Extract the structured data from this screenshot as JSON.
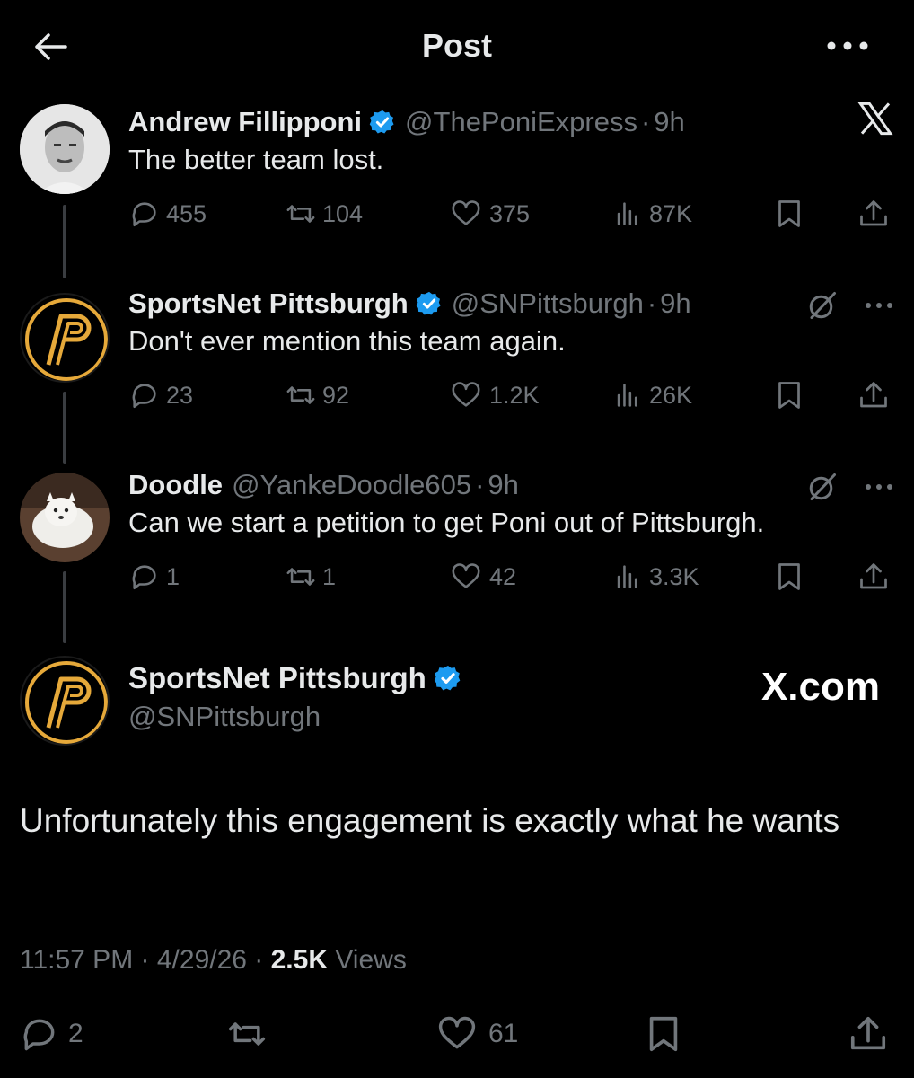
{
  "header": {
    "title": "Post"
  },
  "replies": [
    {
      "name": "Andrew Fillipponi",
      "handle": "@ThePoniExpress",
      "time": "9h",
      "text": "The better team lost.",
      "stats": {
        "replies": "455",
        "reposts": "104",
        "likes": "375",
        "views": "87K"
      }
    },
    {
      "name": "SportsNet Pittsburgh",
      "handle": "@SNPittsburgh",
      "time": "9h",
      "text": "Don't ever mention this team again.",
      "stats": {
        "replies": "23",
        "reposts": "92",
        "likes": "1.2K",
        "views": "26K"
      }
    },
    {
      "name": "Doodle",
      "handle": "@YankeDoodle605",
      "time": "9h",
      "text": "Can we start a petition to get Poni out of Pittsburgh.",
      "stats": {
        "replies": "1",
        "reposts": "1",
        "likes": "42",
        "views": "3.3K"
      }
    }
  ],
  "main": {
    "name": "SportsNet Pittsburgh",
    "handle": "@SNPittsburgh",
    "watermark": "X.com",
    "text": "Unfortunately this engagement is exactly what he wants",
    "time": "11:57 PM",
    "date": "4/29/26",
    "views_count": "2.5K",
    "views_label": "Views",
    "stats": {
      "replies": "2",
      "likes": "61"
    }
  },
  "colors": {
    "background": "#000000",
    "text": "#e7e9ea",
    "muted": "#71767b",
    "verified": "#1d9bf0",
    "snp_gold": "#e6a93a"
  },
  "icons": [
    "back-arrow-icon",
    "more-icon",
    "x-logo-icon",
    "verified-badge-icon",
    "grok-icon",
    "reply-icon",
    "repost-icon",
    "like-icon",
    "views-icon",
    "bookmark-icon",
    "share-icon"
  ]
}
